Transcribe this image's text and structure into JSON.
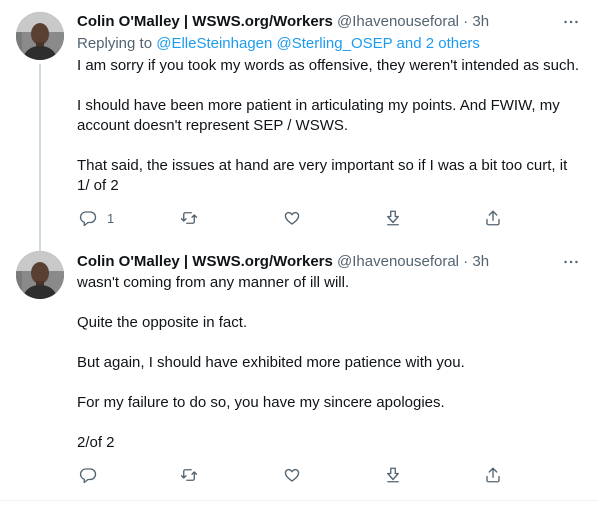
{
  "tweets": [
    {
      "name": "Colin O'Malley | WSWS.org/Workers",
      "handle": "@Ihavenouseforal",
      "separator": " · ",
      "time": "3h",
      "replying_prefix": "Replying to ",
      "replying_mentions": "@ElleSteinhagen @Sterling_OSEP and 2 others",
      "paragraphs": [
        "I am sorry if you took my words as offensive, they weren't intended as such.",
        "I should have been more patient in articulating my points. And FWIW, my account doesn't represent SEP / WSWS.",
        "That said, the issues at hand are very important so if I was a bit too curt, it 1/ of 2"
      ],
      "reply_count": "1"
    },
    {
      "name": "Colin O'Malley | WSWS.org/Workers",
      "handle": "@Ihavenouseforal",
      "separator": " · ",
      "time": "3h",
      "paragraphs": [
        "wasn't coming from any manner of ill will.",
        "Quite the opposite in fact.",
        "But again, I should have exhibited more patience with you.",
        "For my failure to do so, you have my sincere apologies.",
        "2/of 2"
      ],
      "reply_count": ""
    }
  ],
  "icons": {
    "reply": "reply-icon",
    "retweet": "retweet-icon",
    "like": "heart-icon",
    "download": "download-icon",
    "share": "share-icon",
    "more": "more-icon"
  },
  "colors": {
    "link": "#1d9bf0",
    "secondary": "#536471",
    "text": "#0f1419",
    "thread_line": "#cfd9de"
  }
}
